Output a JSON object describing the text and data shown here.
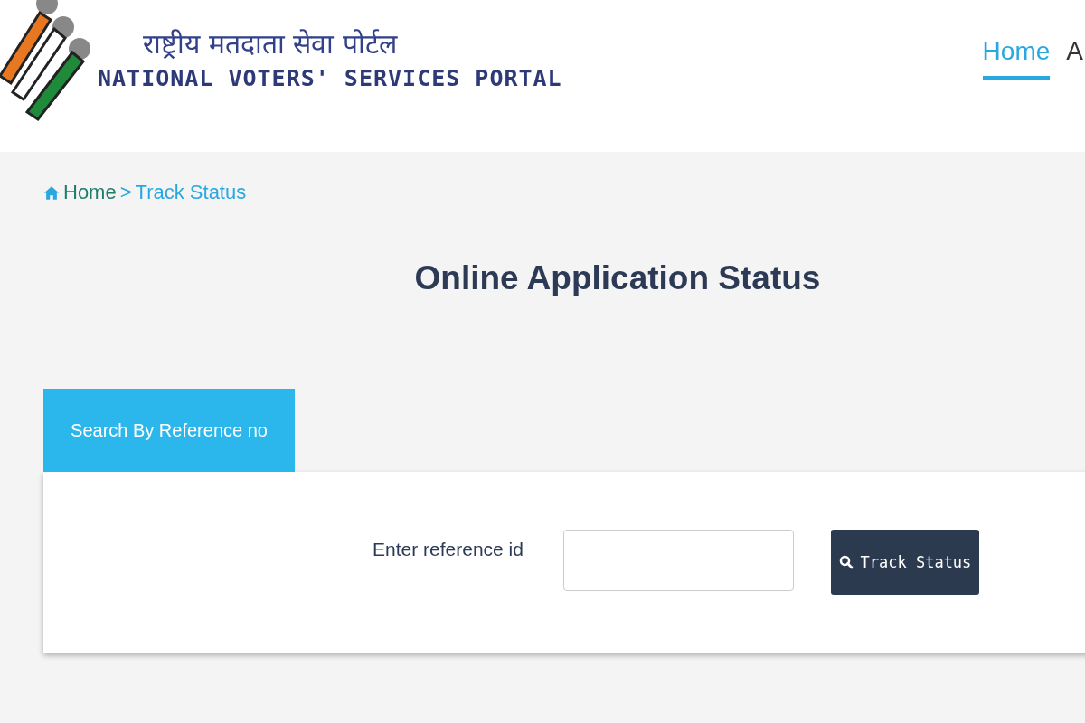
{
  "header": {
    "title_hindi": "राष्ट्रीय मतदाता सेवा पोर्टल",
    "title_english": "NATIONAL VOTERS' SERVICES PORTAL",
    "nav": [
      {
        "label": "Home",
        "selected": true
      },
      {
        "label": "A",
        "selected": false
      }
    ]
  },
  "breadcrumb": [
    {
      "label": "Home",
      "kind": "link"
    },
    {
      "label": ">",
      "kind": "separator"
    },
    {
      "label": "Track Status",
      "kind": "current"
    }
  ],
  "page_title": "Online Application Status",
  "tabs": [
    {
      "label": "Search By Reference no",
      "selected": true
    }
  ],
  "form": {
    "label": "Enter reference id",
    "button": "Track Status"
  }
}
